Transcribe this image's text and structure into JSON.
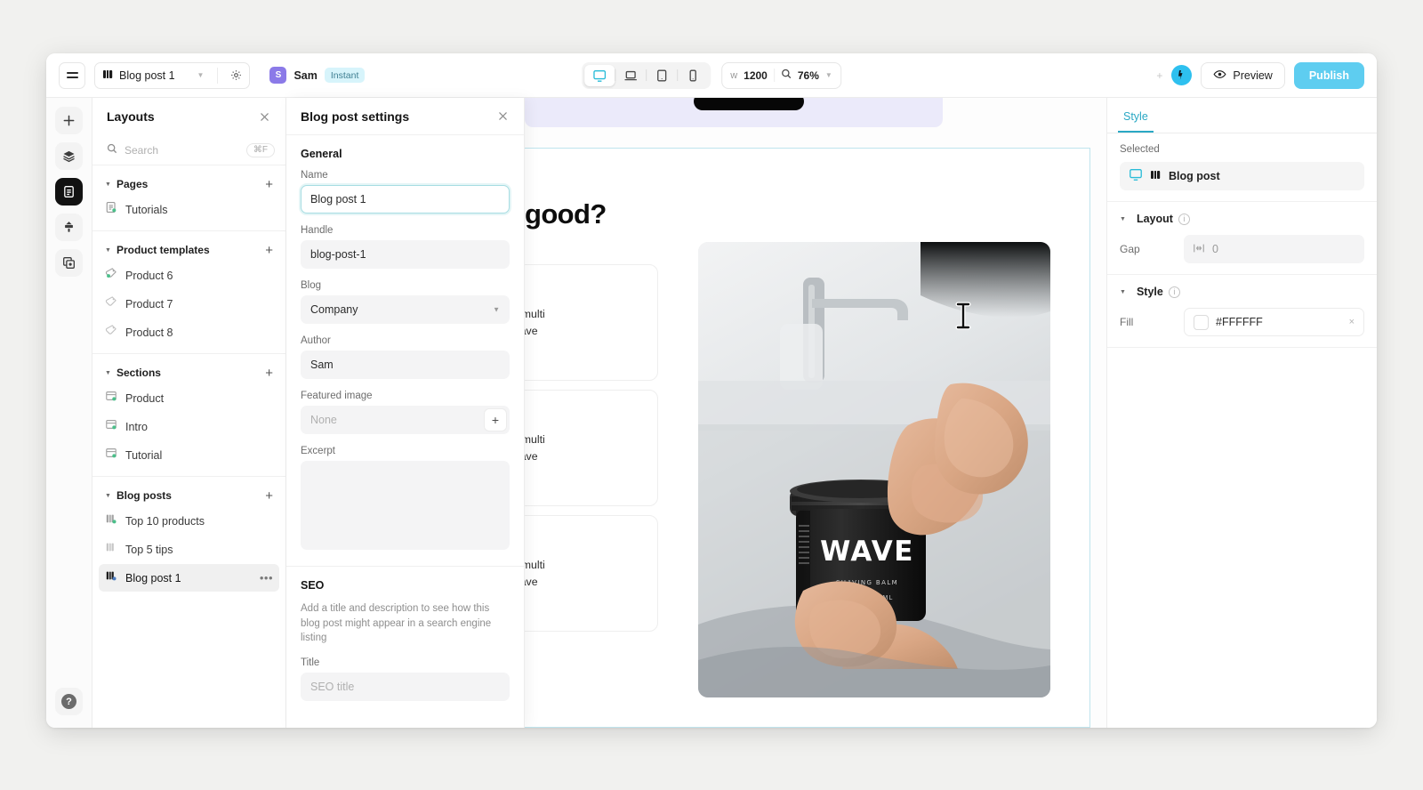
{
  "topbar": {
    "menu_icon": "hamburger-icon",
    "doc_title": "Blog post 1",
    "doc_icon": "blog-post-icon",
    "caret_icon": "chevron-down-icon",
    "gear_icon": "gear-icon",
    "user_initial": "S",
    "user_name": "Sam",
    "plan_badge": "Instant",
    "devices": [
      {
        "name": "desktop",
        "icon": "monitor-icon",
        "active": true
      },
      {
        "name": "laptop",
        "icon": "laptop-icon",
        "active": false
      },
      {
        "name": "tablet",
        "icon": "tablet-icon",
        "active": false
      },
      {
        "name": "mobile",
        "icon": "phone-icon",
        "active": false
      }
    ],
    "width_label": "w",
    "width_value": "1200",
    "zoom_icon": "magnifier-icon",
    "zoom_value": "76%",
    "plus_ghost": "+",
    "brand_icon": "brand-logo-icon",
    "preview_label": "Preview",
    "preview_icon": "eye-icon",
    "publish_label": "Publish",
    "accent_color": "#5ecdf0",
    "active_device_color": "#29bcd8",
    "avatar_color": "#8b7ae8",
    "badge_bg": "#d7f4fb"
  },
  "rail": {
    "items": [
      {
        "name": "add",
        "icon": "plus-icon",
        "active": false
      },
      {
        "name": "layers",
        "icon": "layers-icon",
        "active": false
      },
      {
        "name": "pages",
        "icon": "document-icon",
        "active": true
      },
      {
        "name": "theme",
        "icon": "brush-icon",
        "active": false
      },
      {
        "name": "components",
        "icon": "components-icon",
        "active": false
      }
    ],
    "help_label": "?"
  },
  "layouts": {
    "title": "Layouts",
    "close_icon": "close-icon",
    "search_placeholder": "Search",
    "search_icon": "search-icon",
    "search_shortcut": "⌘F",
    "groups": [
      {
        "name": "Pages",
        "add_label": "+",
        "items": [
          {
            "label": "Tutorials",
            "icon": "page-icon",
            "selected": false
          }
        ]
      },
      {
        "name": "Product templates",
        "add_label": "+",
        "items": [
          {
            "label": "Product 6",
            "icon": "product-template-icon",
            "selected": false
          },
          {
            "label": "Product 7",
            "icon": "product-template-icon",
            "selected": false
          },
          {
            "label": "Product 8",
            "icon": "product-template-icon",
            "selected": false
          }
        ]
      },
      {
        "name": "Sections",
        "add_label": "+",
        "items": [
          {
            "label": "Product",
            "icon": "section-icon",
            "selected": false
          },
          {
            "label": "Intro",
            "icon": "section-icon",
            "selected": false
          },
          {
            "label": "Tutorial",
            "icon": "section-icon",
            "selected": false
          }
        ]
      },
      {
        "name": "Blog posts",
        "add_label": "+",
        "items": [
          {
            "label": "Top 10 products",
            "icon": "blog-post-icon",
            "selected": false
          },
          {
            "label": "Top 5 tips",
            "icon": "blog-post-icon",
            "selected": false
          },
          {
            "label": "Blog post 1",
            "icon": "blog-post-icon",
            "selected": true,
            "more": "•••"
          }
        ]
      }
    ]
  },
  "settings": {
    "title": "Blog post settings",
    "close_icon": "close-icon",
    "general_heading": "General",
    "name_label": "Name",
    "name_value": "Blog post 1",
    "handle_label": "Handle",
    "handle_value": "blog-post-1",
    "blog_label": "Blog",
    "blog_value": "Company",
    "author_label": "Author",
    "author_value": "Sam",
    "featured_image_label": "Featured image",
    "featured_image_placeholder": "None",
    "featured_image_add": "+",
    "excerpt_label": "Excerpt",
    "excerpt_value": "",
    "seo_heading": "SEO",
    "seo_description": "Add a title and description to see how this blog post might appear in a search engine listing",
    "seo_title_label": "Title",
    "seo_title_placeholder": "SEO title"
  },
  "canvas": {
    "headline": "good?",
    "cards": [
      {
        "line1": "ed. Meet the multi",
        "line2": "st-wanted shave"
      },
      {
        "line1": "ed. Meet the multi",
        "line2": "st-wanted shave"
      },
      {
        "line1": "ed. Meet the multi",
        "line2": "st-wanted shave"
      }
    ],
    "hero": {
      "alt": "hand holding black WAVE shaving balm jar in a bathroom",
      "product_name": "WAVE",
      "product_sub": "SHAVING BALM",
      "product_size": "1 OZ • 30 ML"
    }
  },
  "style_panel": {
    "tab_label": "Style",
    "selected_label": "Selected",
    "selected_item": "Blog post",
    "selected_icon": "monitor-icon",
    "selected_type_icon": "blog-post-icon",
    "layout_heading": "Layout",
    "gap_label": "Gap",
    "gap_value": "0",
    "gap_icon": "gap-icon",
    "style_heading": "Style",
    "fill_label": "Fill",
    "fill_value": "#FFFFFF",
    "fill_clear": "×",
    "info_icon": "info-icon"
  }
}
